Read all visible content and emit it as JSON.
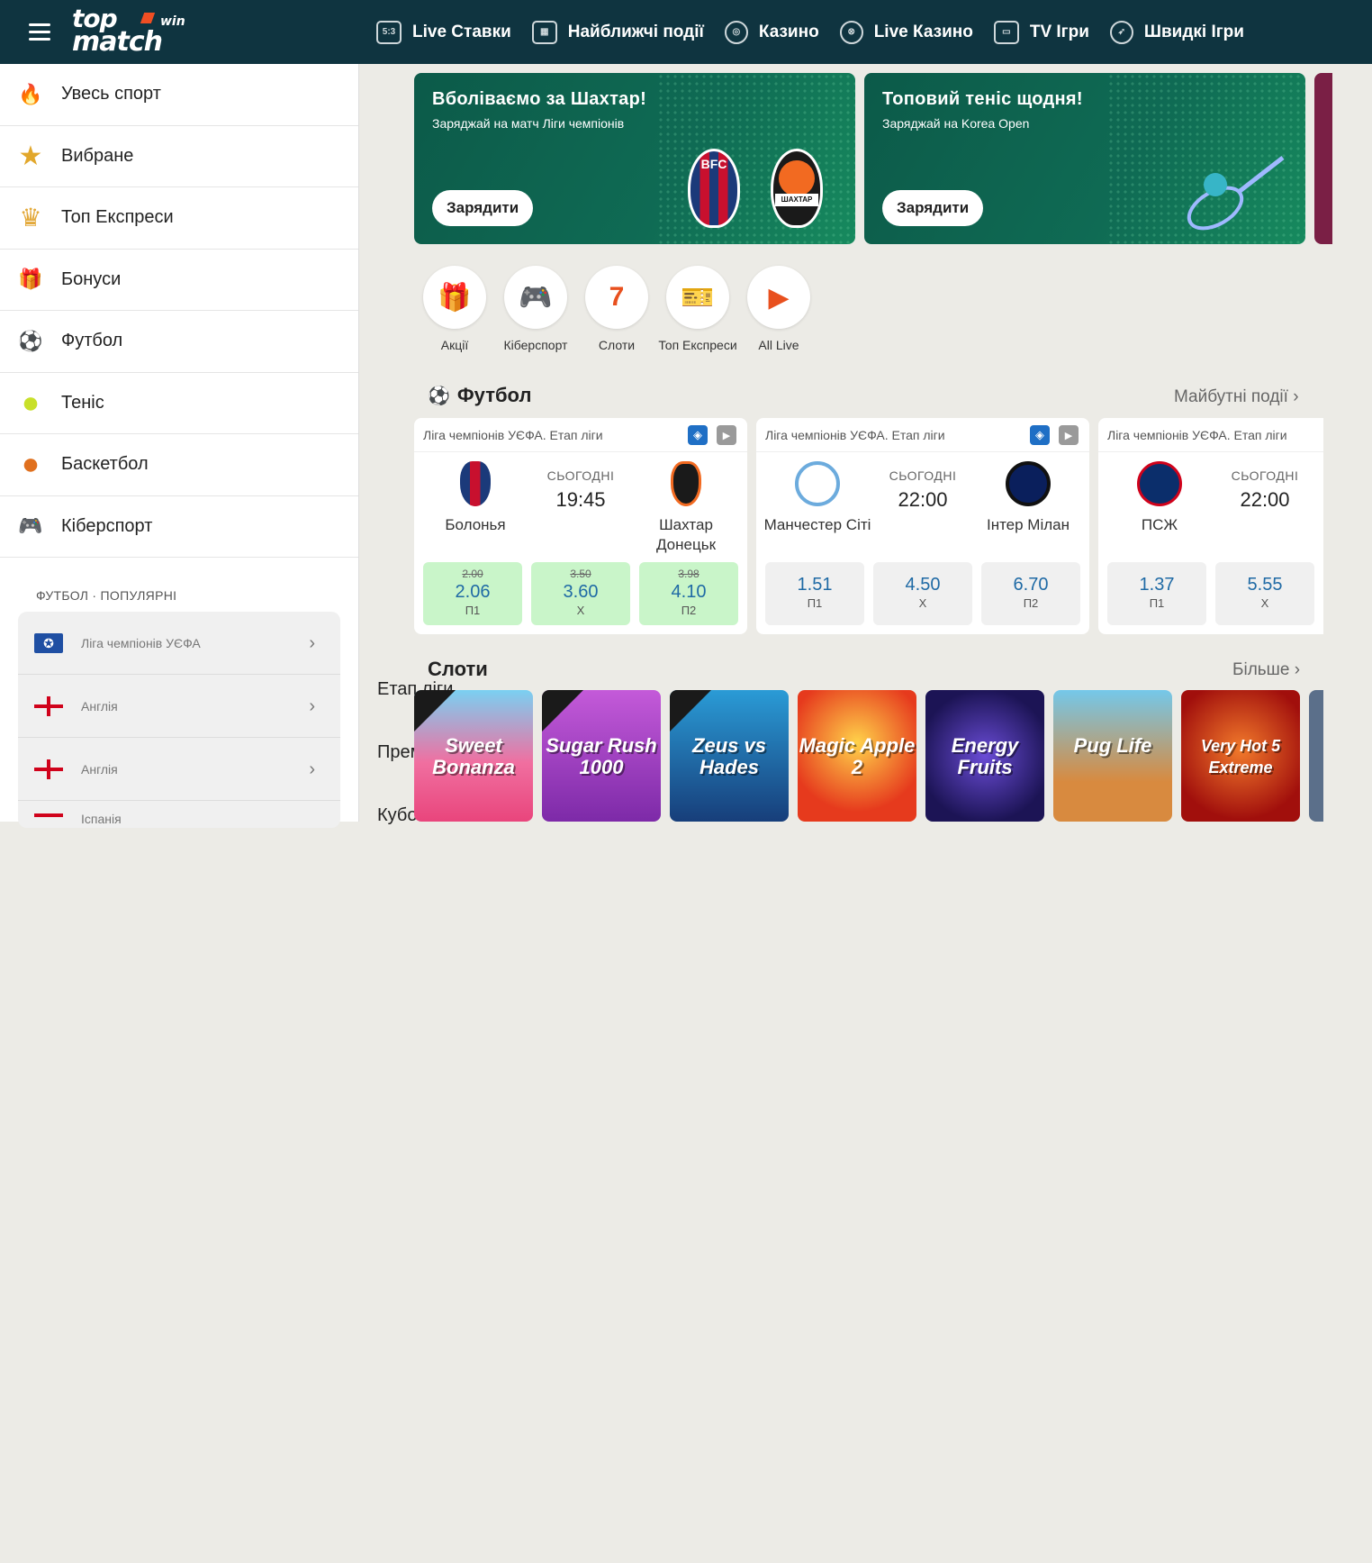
{
  "header": {
    "logo_top": "top",
    "logo_bottom": "match",
    "logo_win": "win",
    "nav": [
      {
        "label": "Live Ставки",
        "icon": "live-score-icon",
        "glyph": "5:3"
      },
      {
        "label": "Найближчі події",
        "icon": "calendar-icon",
        "glyph": "▦"
      },
      {
        "label": "Казино",
        "icon": "casino-chip-icon",
        "glyph": "◎"
      },
      {
        "label": "Live Казино",
        "icon": "live-casino-icon",
        "glyph": "⊗"
      },
      {
        "label": "TV Ігри",
        "icon": "tv-icon",
        "glyph": "▭"
      },
      {
        "label": "Швидкі Ігри",
        "icon": "rocket-icon",
        "glyph": "➶"
      }
    ]
  },
  "sidebar": {
    "items": [
      {
        "label": "Увесь спорт",
        "icon": "fire-icon",
        "glyph": "🔥"
      },
      {
        "label": "Вибране",
        "icon": "star-icon",
        "glyph": "★"
      },
      {
        "label": "Топ Експреси",
        "icon": "crown-icon",
        "glyph": "♛"
      },
      {
        "label": "Бонуси",
        "icon": "gift-icon",
        "glyph": "🎁"
      },
      {
        "label": "Футбол",
        "icon": "football-icon",
        "glyph": "⚽"
      },
      {
        "label": "Теніс",
        "icon": "tennis-ball-icon",
        "glyph": "●"
      },
      {
        "label": "Баскетбол",
        "icon": "basketball-icon",
        "glyph": "●"
      },
      {
        "label": "Кіберспорт",
        "icon": "gamepad-icon",
        "glyph": "🎮"
      }
    ],
    "popular_title": "ФУТБОЛ · ПОПУЛЯРНІ",
    "popular": [
      {
        "sub": "Ліга чемпіонів УЄФА",
        "main": "Етап ліги"
      },
      {
        "sub": "Англія",
        "main": "Прем'єр-ліга"
      },
      {
        "sub": "Англія",
        "main": "Кубок ліги"
      },
      {
        "sub": "Іспанія",
        "main": ""
      }
    ]
  },
  "banners": [
    {
      "title": "Вболіваємо за Шахтар!",
      "subtitle": "Заряджай на матч Ліги чемпіонів",
      "button": "Зарядити",
      "crest1": "BFC",
      "crest2": "ШАХТАР"
    },
    {
      "title": "Топовий теніс щодня!",
      "subtitle": "Заряджай на Korea Open",
      "button": "Зарядити"
    }
  ],
  "quick": [
    {
      "label": "Акції",
      "icon": "gift-box-icon",
      "glyph": "🎁"
    },
    {
      "label": "Кіберспорт",
      "icon": "gamepad-icon",
      "glyph": "🎮"
    },
    {
      "label": "Слоти",
      "icon": "slot-reel-icon",
      "glyph": "7"
    },
    {
      "label": "Топ Експреси",
      "icon": "ticket-icon",
      "glyph": "🎫"
    },
    {
      "label": "All Live",
      "icon": "live-tv-icon",
      "glyph": "▶"
    }
  ],
  "football": {
    "title": "Футбол",
    "link": "Майбутні події",
    "matches": [
      {
        "league": "Ліга чемпіонів УЄФА. Етап ліги",
        "team1": "Болонья",
        "team2": "Шахтар Донецьк",
        "day": "СЬОГОДНІ",
        "time": "19:45",
        "odds": [
          {
            "old": "2.00",
            "val": "2.06",
            "label": "П1"
          },
          {
            "old": "3.50",
            "val": "3.60",
            "label": "Х"
          },
          {
            "old": "3.98",
            "val": "4.10",
            "label": "П2"
          }
        ]
      },
      {
        "league": "Ліга чемпіонів УЄФА. Етап ліги",
        "team1": "Манчестер Сіті",
        "team2": "Інтер Мілан",
        "day": "СЬОГОДНІ",
        "time": "22:00",
        "odds": [
          {
            "val": "1.51",
            "label": "П1"
          },
          {
            "val": "4.50",
            "label": "Х"
          },
          {
            "val": "6.70",
            "label": "П2"
          }
        ]
      },
      {
        "league": "Ліга чемпіонів УЄФА. Етап ліги",
        "team1": "ПСЖ",
        "day": "СЬОГОДНІ",
        "time": "22:00",
        "odds": [
          {
            "val": "1.37",
            "label": "П1"
          },
          {
            "val": "5.55",
            "label": "Х"
          }
        ]
      }
    ]
  },
  "slots": {
    "title": "Слоти",
    "link": "Більше",
    "games": [
      {
        "name": "Sweet Bonanza",
        "color": "#e9457c"
      },
      {
        "name": "Sugar Rush 1000",
        "color": "#9b3fc4"
      },
      {
        "name": "Zeus vs Hades",
        "color": "#1f6fa8"
      },
      {
        "name": "Magic Apple 2",
        "color": "#e63a1d"
      },
      {
        "name": "Energy Fruits",
        "color": "#3a2b8f"
      },
      {
        "name": "Pug Life",
        "color": "#4fb3d9"
      },
      {
        "name": "Very Hot 5 Extreme",
        "color": "#b8130f"
      }
    ]
  },
  "colors": {
    "header_bg": "#0f3440",
    "banner_green": "#0f6b54",
    "odd_up": "#c9f5c9",
    "odd_text": "#1f6aa5"
  }
}
